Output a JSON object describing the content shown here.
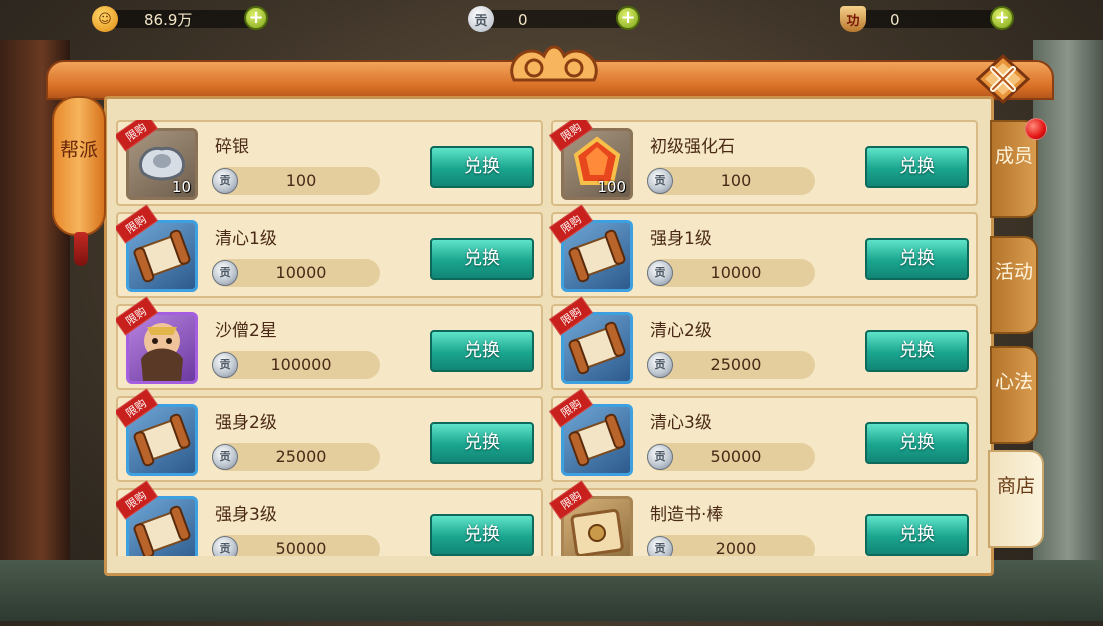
{
  "currencies": [
    {
      "icon": "monkey-coin-icon",
      "glyph": "☺",
      "value": "86.9万"
    },
    {
      "icon": "contribution-coin-icon",
      "glyph": "贡",
      "value": "0"
    },
    {
      "icon": "merit-badge-icon",
      "glyph": "功",
      "value": "0"
    }
  ],
  "guild_tab": {
    "label": "帮派"
  },
  "side_tabs": [
    {
      "label": "成员",
      "active": false
    },
    {
      "label": "活动",
      "active": false
    },
    {
      "label": "心法",
      "active": false
    },
    {
      "label": "商店",
      "active": true
    }
  ],
  "limited_tag": "限购",
  "coin_glyph": "贡",
  "button_label": "兑换",
  "items": [
    {
      "name": "碎银",
      "price": "100",
      "count": "10",
      "frame": "plain",
      "art": "silver-ingot"
    },
    {
      "name": "初级强化石",
      "price": "100",
      "count": "100",
      "frame": "plain",
      "art": "red-gem"
    },
    {
      "name": "清心1级",
      "price": "10000",
      "count": "",
      "frame": "blue",
      "art": "scroll"
    },
    {
      "name": "强身1级",
      "price": "10000",
      "count": "",
      "frame": "blue",
      "art": "scroll"
    },
    {
      "name": "沙僧2星",
      "price": "100000",
      "count": "",
      "frame": "purple",
      "art": "sha-seng-portrait"
    },
    {
      "name": "清心2级",
      "price": "25000",
      "count": "",
      "frame": "blue",
      "art": "scroll"
    },
    {
      "name": "强身2级",
      "price": "25000",
      "count": "",
      "frame": "blue",
      "art": "scroll"
    },
    {
      "name": "清心3级",
      "price": "50000",
      "count": "",
      "frame": "blue",
      "art": "scroll"
    },
    {
      "name": "强身3级",
      "price": "50000",
      "count": "",
      "frame": "blue",
      "art": "scroll"
    },
    {
      "name": "制造书·棒",
      "price": "2000",
      "count": "",
      "frame": "gold",
      "art": "crafting-book"
    }
  ]
}
